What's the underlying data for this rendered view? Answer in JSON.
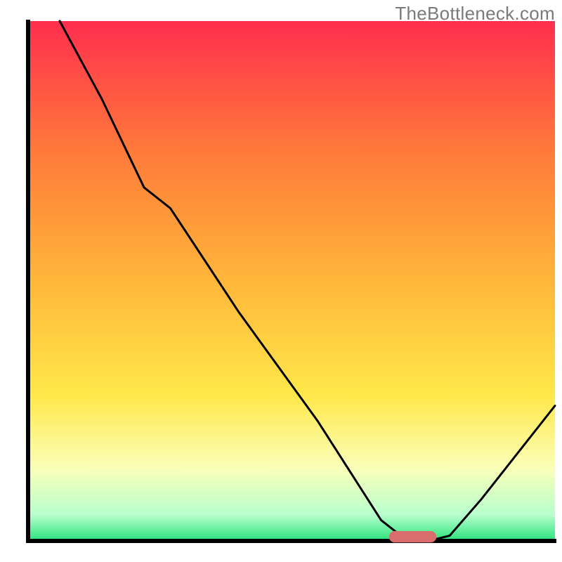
{
  "watermark": "TheBottleneck.com",
  "chart_data": {
    "type": "line",
    "title": "",
    "xlabel": "",
    "ylabel": "",
    "xlim": [
      0,
      100
    ],
    "ylim": [
      0,
      100
    ],
    "x": [
      6,
      14,
      22,
      27,
      40,
      55,
      67,
      72,
      76,
      80,
      86,
      100
    ],
    "values": [
      100,
      85,
      68,
      64,
      44,
      23,
      4,
      0,
      0,
      1,
      8,
      26
    ],
    "optimal_range_x": [
      67,
      78
    ],
    "marker": {
      "x_center": 73,
      "y": 0.8,
      "width": 9,
      "height": 2.2,
      "color": "#d96d6d"
    },
    "gradient_stops": [
      {
        "offset": 0.0,
        "color": "#ff2e4e"
      },
      {
        "offset": 0.25,
        "color": "#ff7a3a"
      },
      {
        "offset": 0.5,
        "color": "#ffb63a"
      },
      {
        "offset": 0.72,
        "color": "#ffe84a"
      },
      {
        "offset": 0.86,
        "color": "#faffb8"
      },
      {
        "offset": 0.95,
        "color": "#b8ffce"
      },
      {
        "offset": 1.0,
        "color": "#28e27a"
      }
    ],
    "axis_stroke": "#000000",
    "axis_width": 6,
    "curve_stroke": "#000000",
    "curve_width": 3
  }
}
